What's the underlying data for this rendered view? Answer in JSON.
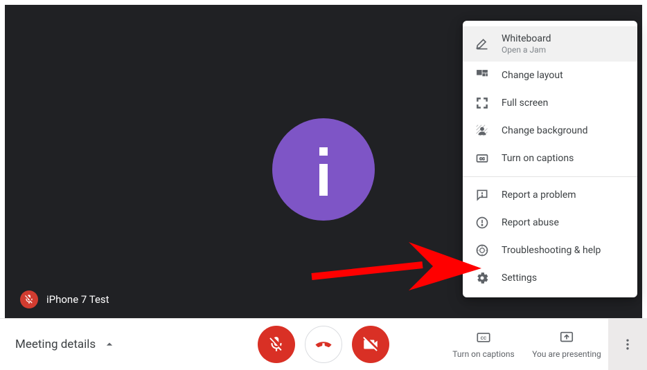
{
  "participant": {
    "name": "iPhone 7 Test",
    "avatar_letter": "i",
    "muted": true
  },
  "menu": {
    "items": [
      {
        "label": "Whiteboard",
        "sub": "Open a Jam",
        "icon": "pencil-icon"
      },
      {
        "label": "Change layout",
        "icon": "layout-icon"
      },
      {
        "label": "Full screen",
        "icon": "fullscreen-icon"
      },
      {
        "label": "Change background",
        "icon": "background-icon"
      },
      {
        "label": "Turn on captions",
        "icon": "cc-small-icon"
      }
    ],
    "items2": [
      {
        "label": "Report a problem",
        "icon": "feedback-icon"
      },
      {
        "label": "Report abuse",
        "icon": "warning-icon"
      },
      {
        "label": "Troubleshooting & help",
        "icon": "help-icon"
      },
      {
        "label": "Settings",
        "icon": "gear-icon"
      }
    ]
  },
  "bottom": {
    "meeting_details": "Meeting details",
    "captions": "Turn on captions",
    "presenting": "You are presenting"
  },
  "colors": {
    "accent_purple": "#7e55c6",
    "accent_red": "#d93025"
  }
}
